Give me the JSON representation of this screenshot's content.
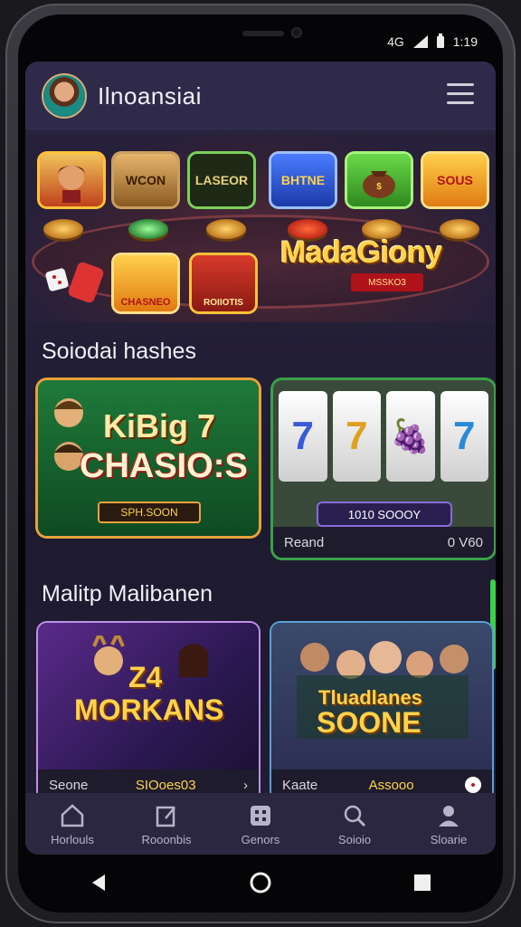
{
  "status_bar": {
    "network": "4G",
    "time": "1:19"
  },
  "header": {
    "app_title": "Ilnoansiai",
    "menu_icon": "hamburger-menu-icon"
  },
  "hero": {
    "tiles": [
      "WCON",
      "LASEOR",
      "BHTNE",
      "SOUS",
      "CHASNEO",
      "ROIIOTIS"
    ],
    "banner_title": "MadaGiony",
    "banner_sub": "MSSKO3"
  },
  "section1": {
    "title": "Soiodai hashes",
    "card1": {
      "title_line1": "KiBig 7",
      "title_line2": "CHASIO:S",
      "tag": "SPH.SOON"
    },
    "card2": {
      "reels": [
        "7",
        "7",
        "🍇",
        "7"
      ],
      "tag": "1010 SOOOY",
      "footer_left": "Reand",
      "footer_right": "0 V60"
    }
  },
  "section2": {
    "title": "Malitp Malibanen",
    "card1": {
      "art_title": "MORKANS",
      "art_num": "Z4",
      "footer_left": "Seone",
      "footer_mid": "SIOoes03",
      "footer_icon": "chevron-right-icon"
    },
    "card2": {
      "art_title_line1": "Tluadlanes",
      "art_title_line2": "SOONE",
      "footer_left": "Kaate",
      "footer_mid": "Assooo",
      "footer_icon": "dice-icon"
    }
  },
  "bottom_nav": [
    {
      "label": "Horlouls",
      "icon": "home-icon"
    },
    {
      "label": "Rooonbis",
      "icon": "edit-icon"
    },
    {
      "label": "Genors",
      "icon": "grid-icon"
    },
    {
      "label": "Soioio",
      "icon": "search-icon"
    },
    {
      "label": "Sloarie",
      "icon": "profile-icon"
    }
  ],
  "colors": {
    "accent_gold": "#ffd24a",
    "screen_bg": "#1e1a30",
    "nav_bg": "#2b2740"
  }
}
